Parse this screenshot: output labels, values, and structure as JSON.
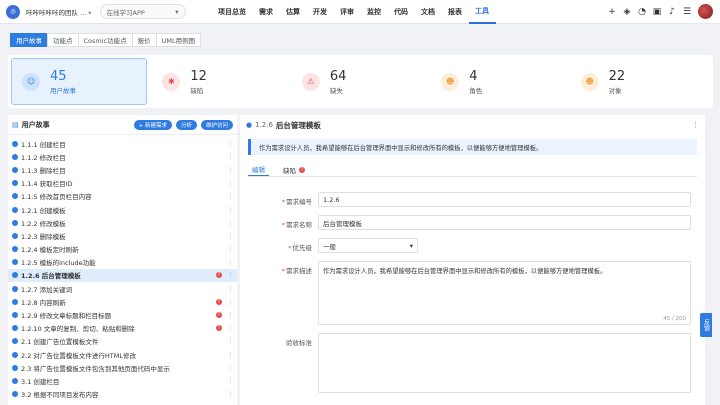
{
  "topbar": {
    "team": "咔咔咔咔咔的团队 ...",
    "project": "在线学习APP",
    "nav": [
      "项目总览",
      "需求",
      "估算",
      "开发",
      "评审",
      "监控",
      "代码",
      "文档",
      "报表",
      "工具"
    ],
    "active_nav": 9
  },
  "tabs": [
    "用户故事",
    "功能点",
    "Cosmic功能点",
    "报价",
    "UML用例图"
  ],
  "stats": [
    {
      "num": "45",
      "label": "用户故事",
      "color": "#2f7be0"
    },
    {
      "num": "12",
      "label": "缺陷",
      "color": "#e94b4b"
    },
    {
      "num": "64",
      "label": "缺失",
      "color": "#e94b4b"
    },
    {
      "num": "4",
      "label": "角色",
      "color": "#f0a040"
    },
    {
      "num": "22",
      "label": "对象",
      "color": "#f0a040"
    }
  ],
  "left": {
    "title": "用户故事",
    "btn_new": "+ 新建需求",
    "btn_analyze": "分析",
    "btn_maintain": "维护访问",
    "rows": [
      {
        "label": "1.1.1 创建栏目",
        "err": ""
      },
      {
        "label": "1.1.2 修改栏目",
        "err": ""
      },
      {
        "label": "1.1.3 删除栏目",
        "err": ""
      },
      {
        "label": "1.1.4 获取栏目ID",
        "err": ""
      },
      {
        "label": "1.1.5 修改首页栏目内容",
        "err": ""
      },
      {
        "label": "1.2.1 创建模板",
        "err": ""
      },
      {
        "label": "1.2.2 修改模板",
        "err": ""
      },
      {
        "label": "1.2.3 删除模板",
        "err": ""
      },
      {
        "label": "1.2.4 模板定时刷新",
        "err": ""
      },
      {
        "label": "1.2.5 模板的include功能",
        "err": ""
      },
      {
        "label": "1.2.6 后台管理模板",
        "err": "!"
      },
      {
        "label": "1.2.7 添加关键词",
        "err": ""
      },
      {
        "label": "1.2.8 内容刷新",
        "err": "!"
      },
      {
        "label": "1.2.9 修改文章标题和栏目标题",
        "err": "!"
      },
      {
        "label": "1.2.10 文章的复制、剪切、粘贴和删除",
        "err": "!"
      },
      {
        "label": "2.1 创建广告位置模板文件",
        "err": ""
      },
      {
        "label": "2.2 对广告位置模板文件进行HTML修改",
        "err": ""
      },
      {
        "label": "2.3 将广告位置模板文件包含到其他页面代码中显示",
        "err": ""
      },
      {
        "label": "3.1 创建栏目",
        "err": ""
      },
      {
        "label": "3.2 根据不同项目发布内容",
        "err": ""
      }
    ]
  },
  "right": {
    "num": "1.2.6",
    "title": "后台管理模板",
    "desc": "作为需求设计人员，我希望能够在后台管理界面中显示和修改所有的模板，以便能够方便地管理模板。",
    "subtabs": [
      "编辑",
      "缺陷"
    ],
    "form": {
      "code_label": "需求编号",
      "code": "1.2.6",
      "name_label": "需求名称",
      "name": "后台管理模板",
      "prio_label": "优先级",
      "prio": "一般",
      "desc_label": "需求描述",
      "desc": "作为需求设计人员，我希望能够在后台管理界面中显示和修改所有的模板，以便能够方便地管理模板。",
      "counter": "45 / 200",
      "accept_label": "验收标准"
    }
  },
  "feedback": "反馈"
}
